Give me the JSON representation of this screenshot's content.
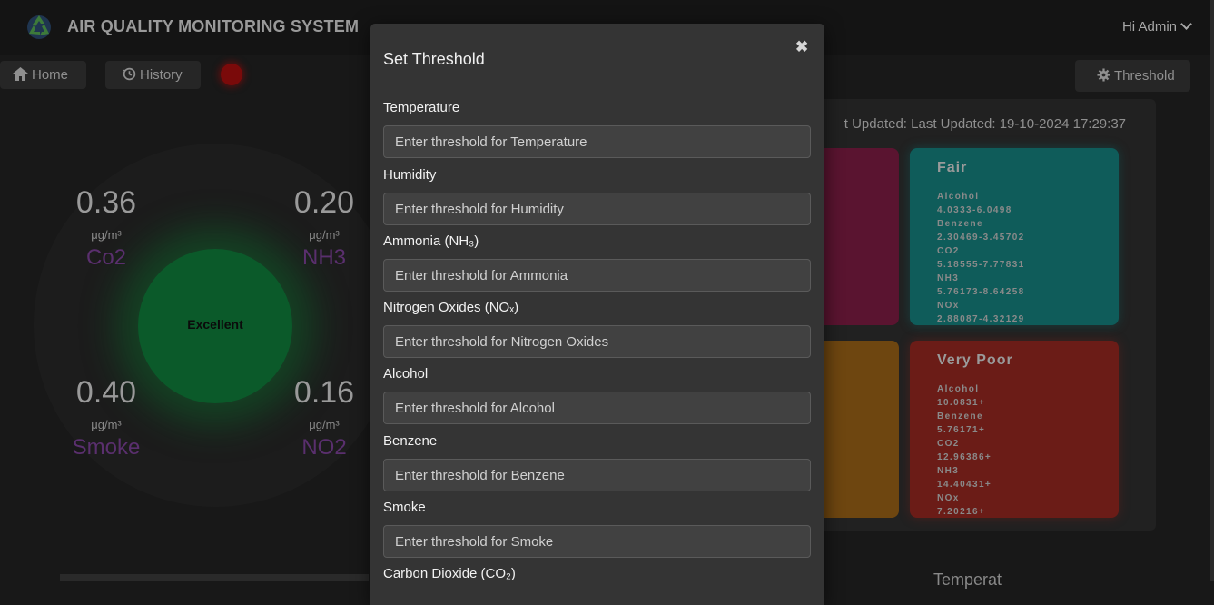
{
  "header": {
    "app_title": "AIR QUALITY MONITORING SYSTEM",
    "user_greeting": "Hi Admin"
  },
  "nav": {
    "home_label": "Home",
    "history_label": "History",
    "threshold_label": "Threshold"
  },
  "gauge": {
    "status": "Excellent",
    "readings": [
      {
        "value": "0.36",
        "unit": "μg/m³",
        "name": "Co2"
      },
      {
        "value": "0.20",
        "unit": "μg/m³",
        "name": "NH3"
      },
      {
        "value": "0.40",
        "unit": "μg/m³",
        "name": "Smoke"
      },
      {
        "value": "0.16",
        "unit": "μg/m³",
        "name": "NO2"
      }
    ]
  },
  "aq_panel": {
    "last_updated": "t Updated: Last Updated: 19-10-2024 17:29:37",
    "fair": {
      "title": "Fair",
      "lines": [
        "Alcohol",
        "4.0333-6.0498",
        "Benzene",
        "2.30469-3.45702",
        "CO2",
        "5.18555-7.77831",
        "NH3",
        "5.76173-8.64258",
        "NOx",
        "2.88087-4.32129"
      ]
    },
    "very_poor": {
      "title": "Very Poor",
      "lines": [
        "Alcohol",
        "10.0831+",
        "Benzene",
        "5.76171+",
        "CO2",
        "12.96386+",
        "NH3",
        "14.40431+",
        "NOx",
        "7.20216+"
      ]
    }
  },
  "modal": {
    "title": "Set Threshold",
    "close_symbol": "✖",
    "fields": [
      {
        "label": "Temperature",
        "placeholder": "Enter threshold for Temperature"
      },
      {
        "label": "Humidity",
        "placeholder": "Enter threshold for Humidity"
      },
      {
        "label": "Ammonia (NH₃)",
        "placeholder": "Enter threshold for Ammonia"
      },
      {
        "label": "Nitrogen Oxides (NOₓ)",
        "placeholder": "Enter threshold for Nitrogen Oxides"
      },
      {
        "label": "Alcohol",
        "placeholder": "Enter threshold for Alcohol"
      },
      {
        "label": "Benzene",
        "placeholder": "Enter threshold for Benzene"
      },
      {
        "label": "Smoke",
        "placeholder": "Enter threshold for Smoke"
      },
      {
        "label": "Carbon Dioxide (CO₂)",
        "placeholder": ""
      }
    ]
  },
  "footer": {
    "partial_heading": "Temperat"
  },
  "colors": {
    "status_good": "#0b5a2a",
    "status_alert": "#7a0a0a",
    "card_fair": "#0f5c5a",
    "card_very_poor": "#6b1c17"
  },
  "icons": [
    "recycle-logo-icon",
    "home-icon",
    "history-icon",
    "gear-icon",
    "chevron-down-icon",
    "close-icon"
  ]
}
